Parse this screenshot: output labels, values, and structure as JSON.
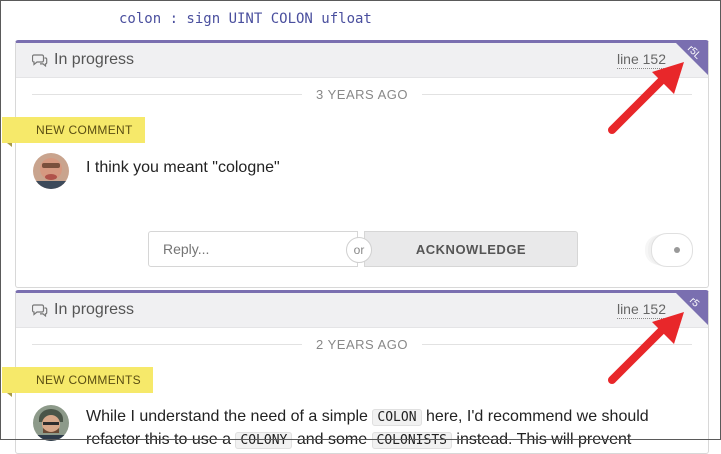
{
  "code": {
    "line_text": "colon : sign UINT COLON ufloat"
  },
  "threads": [
    {
      "status": "In progress",
      "line_ref": "line 152",
      "corner_label": "r5L",
      "time_ago": "3 YEARS AGO",
      "ribbon": "NEW COMMENT",
      "comment": "I think you meant \"cologne\"",
      "reply_placeholder": "Reply...",
      "or_label": "or",
      "acknowledge_label": "ACKNOWLEDGE"
    },
    {
      "status": "In progress",
      "line_ref": "line 152",
      "corner_label": "r5",
      "time_ago": "2 YEARS AGO",
      "ribbon": "NEW COMMENTS",
      "comment_parts": {
        "l1_a": "While I understand the need of a simple ",
        "l1_code": "COLON",
        "l1_b": " here, I'd recommend we should",
        "l2_a": "refactor this to use a ",
        "l2_code1": "COLONY",
        "l2_b": " and some ",
        "l2_code2": "COLONISTS",
        "l2_c": " instead. This will prevent"
      }
    }
  ],
  "colors": {
    "accent": "#7a6fb0",
    "ribbon": "#f6e96a",
    "arrow": "#e8272a"
  },
  "icons": [
    "comments-icon",
    "arrow-annotation"
  ]
}
